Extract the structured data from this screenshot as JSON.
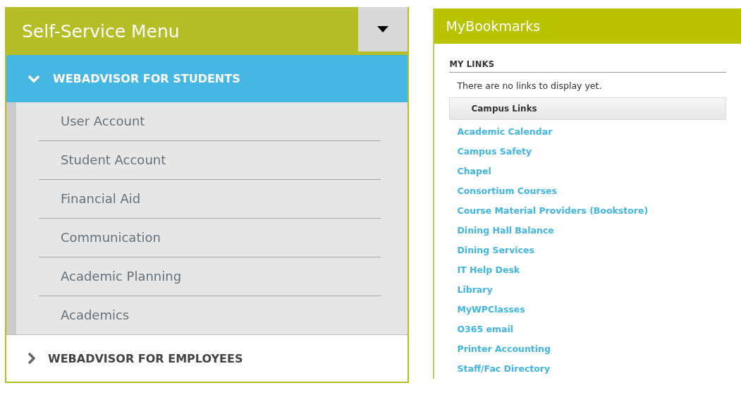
{
  "self_service": {
    "title": "Self-Service Menu",
    "sections": [
      {
        "label": "WEBADVISOR FOR STUDENTS",
        "expanded": true,
        "items": [
          "User Account",
          "Student Account",
          "Financial Aid",
          "Communication",
          "Academic Planning",
          "Academics"
        ]
      },
      {
        "label": "WEBADVISOR FOR EMPLOYEES",
        "expanded": false
      }
    ]
  },
  "bookmarks": {
    "title": "MyBookmarks",
    "my_links_heading": "MY LINKS",
    "empty_message": "There are no links to display yet.",
    "group_heading": "Campus Links",
    "links": [
      "Academic Calendar",
      "Campus Safety",
      "Chapel",
      "Consortium Courses",
      "Course Material Providers (Bookstore)",
      "Dining Hall Balance",
      "Dining Services",
      "IT Help Desk",
      "Library",
      "MyWPClasses",
      "O365 email",
      "Printer Accounting",
      "Staff/Fac Directory"
    ]
  }
}
